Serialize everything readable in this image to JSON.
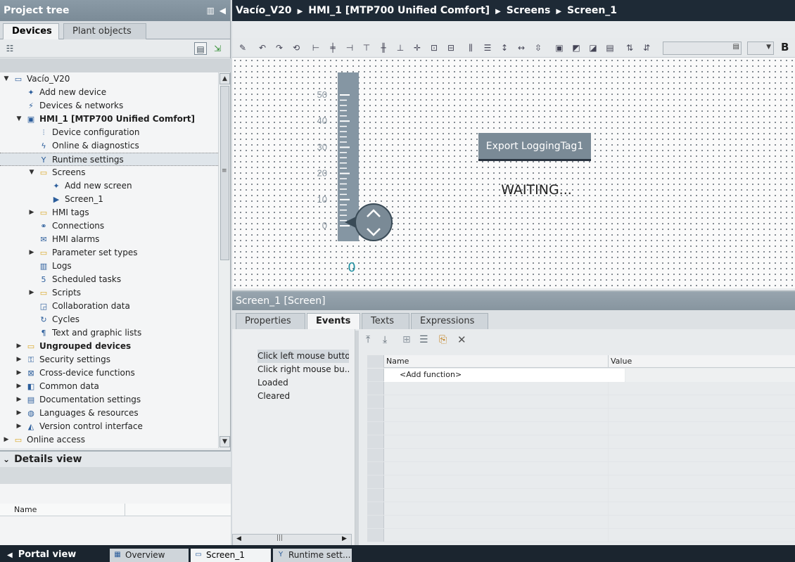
{
  "project_tree": {
    "title": "Project tree",
    "tabs": [
      "Devices",
      "Plant objects"
    ],
    "items": [
      {
        "label": "Vacío_V20",
        "icon": "project-icon",
        "expander": "▼",
        "bold": false
      },
      {
        "label": "Add new device",
        "icon": "add-device-icon",
        "expander": "",
        "bold": false
      },
      {
        "label": "Devices & networks",
        "icon": "network-icon",
        "expander": "",
        "bold": false
      },
      {
        "label": "HMI_1 [MTP700 Unified Comfort]",
        "icon": "hmi-icon",
        "expander": "▼",
        "bold": true
      },
      {
        "label": "Device configuration",
        "icon": "device-config-icon",
        "expander": "",
        "bold": false
      },
      {
        "label": "Online & diagnostics",
        "icon": "diagnostics-icon",
        "expander": "",
        "bold": false
      },
      {
        "label": "Runtime settings",
        "icon": "runtime-settings-icon",
        "expander": "",
        "bold": false,
        "selected": true
      },
      {
        "label": "Screens",
        "icon": "folder-icon",
        "expander": "▼",
        "bold": false
      },
      {
        "label": "Add new screen",
        "icon": "add-screen-icon",
        "expander": "",
        "bold": false
      },
      {
        "label": "Screen_1",
        "icon": "screen-icon",
        "expander": "",
        "bold": false
      },
      {
        "label": "HMI tags",
        "icon": "tags-folder-icon",
        "expander": "▶",
        "bold": false
      },
      {
        "label": "Connections",
        "icon": "connections-icon",
        "expander": "",
        "bold": false
      },
      {
        "label": "HMI alarms",
        "icon": "alarms-icon",
        "expander": "",
        "bold": false
      },
      {
        "label": "Parameter set types",
        "icon": "folder-icon",
        "expander": "▶",
        "bold": false
      },
      {
        "label": "Logs",
        "icon": "logs-icon",
        "expander": "",
        "bold": false
      },
      {
        "label": "Scheduled tasks",
        "icon": "scheduled-tasks-icon",
        "expander": "",
        "bold": false
      },
      {
        "label": "Scripts",
        "icon": "folder-icon",
        "expander": "▶",
        "bold": false
      },
      {
        "label": "Collaboration data",
        "icon": "collaboration-icon",
        "expander": "",
        "bold": false
      },
      {
        "label": "Cycles",
        "icon": "cycles-icon",
        "expander": "",
        "bold": false
      },
      {
        "label": "Text and graphic lists",
        "icon": "text-lists-icon",
        "expander": "",
        "bold": false
      },
      {
        "label": "Ungrouped devices",
        "icon": "devices-folder-icon",
        "expander": "▶",
        "bold": true
      },
      {
        "label": "Security settings",
        "icon": "security-icon",
        "expander": "▶",
        "bold": false
      },
      {
        "label": "Cross-device functions",
        "icon": "cross-device-icon",
        "expander": "▶",
        "bold": false
      },
      {
        "label": "Common data",
        "icon": "common-data-icon",
        "expander": "▶",
        "bold": false
      },
      {
        "label": "Documentation settings",
        "icon": "documentation-icon",
        "expander": "▶",
        "bold": false
      },
      {
        "label": "Languages & resources",
        "icon": "languages-icon",
        "expander": "▶",
        "bold": false
      },
      {
        "label": "Version control interface",
        "icon": "version-control-icon",
        "expander": "▶",
        "bold": false
      },
      {
        "label": "Online access",
        "icon": "online-access-icon",
        "expander": "▶",
        "bold": false
      }
    ]
  },
  "details_view": {
    "title": "Details view",
    "column_name": "Name"
  },
  "breadcrumb": [
    "Vacío_V20",
    "HMI_1 [MTP700 Unified Comfort]",
    "Screens",
    "Screen_1"
  ],
  "editor": {
    "bold_label": "B",
    "slider": {
      "ticks": [
        "50",
        "40",
        "30",
        "20",
        "10",
        "0"
      ],
      "value": "0",
      "max": 50,
      "min": 0
    },
    "export_button_label": "Export LoggingTag1",
    "status_text": "WAITING..."
  },
  "properties": {
    "title": "Screen_1 [Screen]",
    "tabs": [
      "Properties",
      "Events",
      "Texts",
      "Expressions"
    ],
    "active_tab": "Events",
    "events": [
      "Click left mouse button",
      "Click right mouse bu...",
      "Loaded",
      "Cleared"
    ],
    "grid_headers": {
      "name": "Name",
      "value": "Value"
    },
    "add_function": "<Add function>"
  },
  "taskbar": {
    "portal_view": "Portal view",
    "items": [
      {
        "label": "Overview",
        "icon": "overview-icon"
      },
      {
        "label": "Screen_1",
        "icon": "screen-icon"
      },
      {
        "label": "Runtime sett...",
        "icon": "runtime-settings-icon"
      }
    ]
  },
  "colors": {
    "breadcrumb_bg": "#1e2a36",
    "panel_title_bg": "#8a9aa6",
    "button_bg": "#7a8a96",
    "slider_track": "#8596a3",
    "slider_value": "#1e8fa0"
  }
}
